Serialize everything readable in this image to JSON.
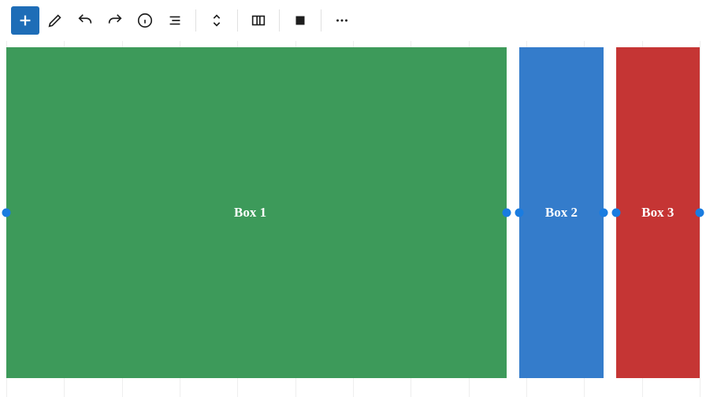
{
  "toolbar": {
    "icons": {
      "add": "add-icon",
      "edit": "edit-icon",
      "undo": "undo-icon",
      "redo": "redo-icon",
      "info": "info-icon",
      "menu": "menu-icon",
      "move": "move-icon",
      "columns": "columns-icon",
      "color": "color-icon",
      "more": "more-icon"
    }
  },
  "columns": {
    "items": [
      {
        "label": "Box 1",
        "color": "#3d9a5a",
        "span": "wide"
      },
      {
        "label": "Box 2",
        "color": "#347ccb",
        "span": "narrow"
      },
      {
        "label": "Box 3",
        "color": "#c53534",
        "span": "narrow"
      }
    ]
  },
  "handles": {
    "color": "#1a7ce0"
  }
}
